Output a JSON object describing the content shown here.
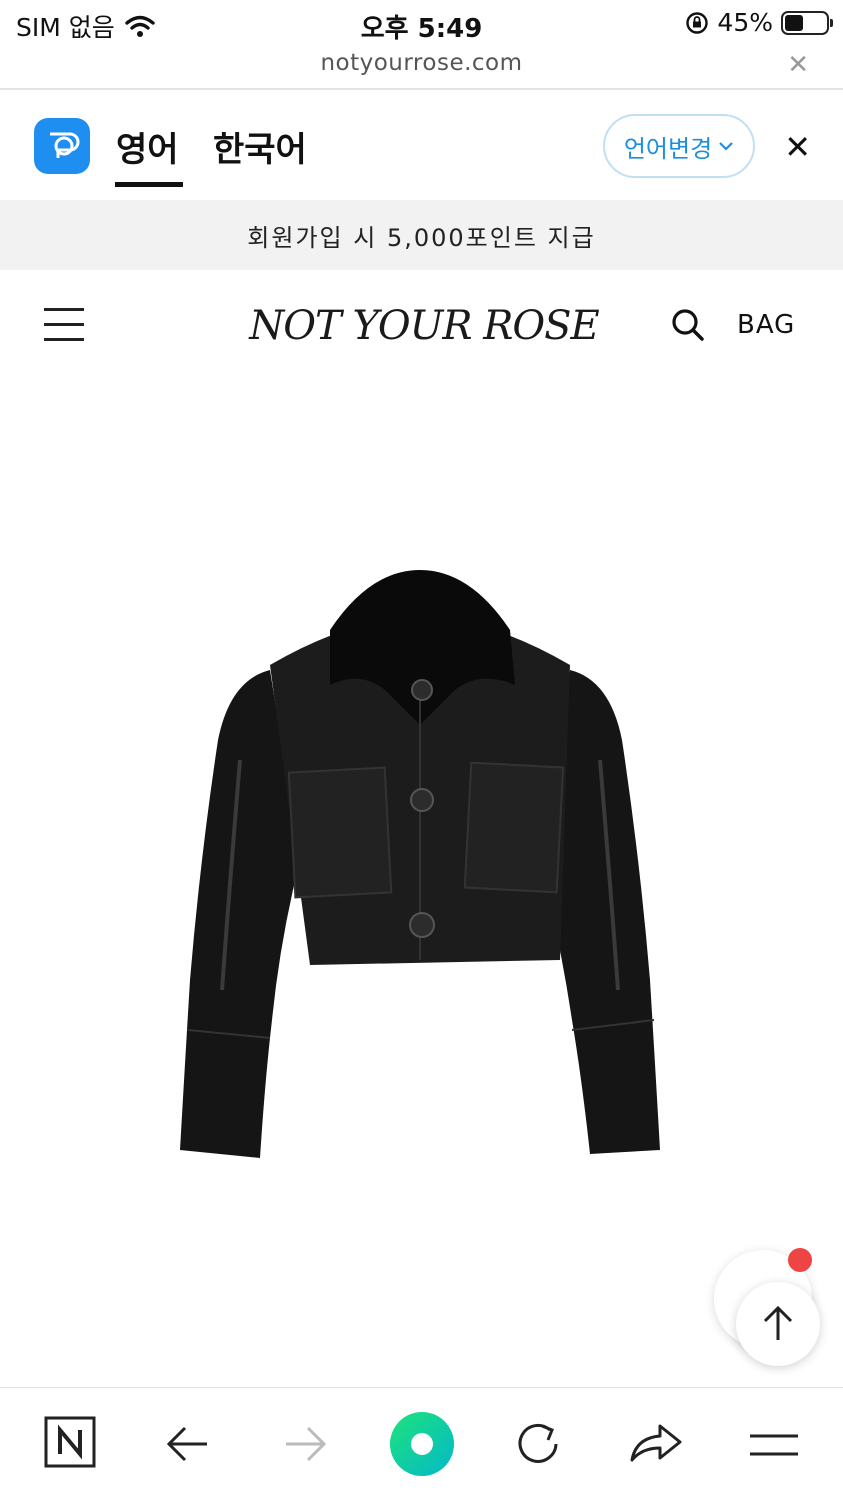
{
  "status_bar": {
    "carrier": "SIM 없음",
    "time": "오후 5:49",
    "battery": "45%",
    "battery_level": 0.45
  },
  "url_bar": {
    "url": "notyourrose.com"
  },
  "language_bar": {
    "active_tab": "영어",
    "other_tab": "한국어",
    "change_button": "언어변경"
  },
  "promo": {
    "text": "회원가입 시 5,000포인트 지급"
  },
  "header": {
    "logo": "NOT YOUR ROSE",
    "bag_label": "BAG"
  },
  "colors": {
    "accent_blue": "#1e8fdc",
    "app_icon_blue": "#1f8ef1",
    "notification_red": "#ee4444",
    "naver_green": "#03c75a"
  },
  "icons": {
    "wifi": "wifi-icon",
    "lock_rotation": "rotation-lock-icon",
    "search": "search-icon",
    "menu": "hamburger-icon",
    "back": "arrow-left-icon",
    "forward": "arrow-right-icon",
    "reload": "reload-icon",
    "share": "share-icon",
    "more": "menu-icon",
    "scroll_top": "arrow-up-icon"
  }
}
